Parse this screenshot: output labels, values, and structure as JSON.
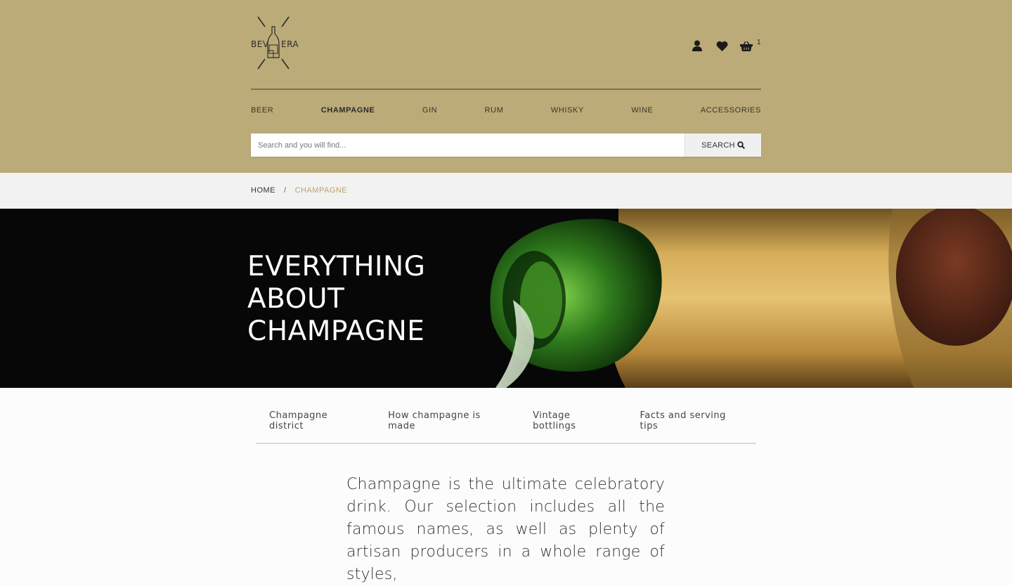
{
  "logo": {
    "text_left": "BEV",
    "text_right": "ERA"
  },
  "header": {
    "cart_count": "1",
    "icons": [
      "user-icon",
      "heart-icon",
      "basket-icon"
    ]
  },
  "nav": {
    "items": [
      {
        "label": "BEER"
      },
      {
        "label": "CHAMPAGNE",
        "active": true
      },
      {
        "label": "GIN"
      },
      {
        "label": "RUM"
      },
      {
        "label": "WHISKY"
      },
      {
        "label": "WINE"
      },
      {
        "label": "ACCESSORIES"
      }
    ]
  },
  "search": {
    "placeholder": "Search and you will find...",
    "button_label": "SEARCH"
  },
  "breadcrumb": {
    "home": "HOME",
    "separator": "/",
    "current": "CHAMPAGNE"
  },
  "hero": {
    "title_lines": [
      "EVERYTHING",
      "ABOUT",
      "CHAMPAGNE"
    ]
  },
  "subtabs": [
    {
      "label": "Champagne district"
    },
    {
      "label": "How champagne is made"
    },
    {
      "label": "Vintage bottlings"
    },
    {
      "label": "Facts and serving tips"
    }
  ],
  "intro": {
    "text": "Champagne is the ultimate celebratory drink. Our selection includes all the famous names, as well as plenty of artisan producers in a whole range of styles,"
  },
  "colors": {
    "header_bg": "#bbab78",
    "breadcrumb_bg": "#f2f2f2",
    "accent": "#bba26a",
    "hero_bg": "#070707"
  }
}
